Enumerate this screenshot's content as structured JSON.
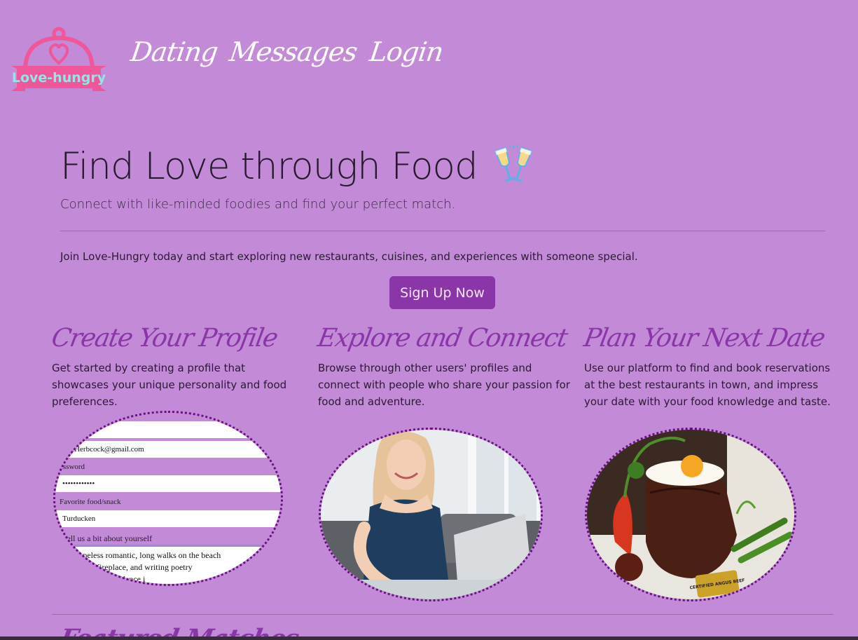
{
  "brand": {
    "logo_text": "Love-hungry"
  },
  "nav": {
    "items": [
      "Dating",
      "Messages",
      "Login"
    ]
  },
  "hero": {
    "title": "Find Love through Food",
    "lead": "Connect with like-minded foodies and find your perfect match.",
    "body": "Join Love-Hungry today and start exploring new restaurants, cuisines, and experiences with someone special.",
    "cta": "Sign Up Now",
    "icon": "clinking-glasses-icon"
  },
  "features": [
    {
      "title": "Create Your Profile",
      "text": "Get started by creating a profile that showcases your unique personality and food preferences."
    },
    {
      "title": "Explore and Connect",
      "text": "Browse through other users' profiles and connect with people who share your passion for food and adventure."
    },
    {
      "title": "Plan Your Next Date",
      "text": "Use our platform to find and book reservations at the best restaurants in town, and impress your date with your food knowledge and taste."
    }
  ],
  "form_preview": {
    "email_value": "rbieHerbcock@gmail.com",
    "password_label": "assword",
    "password_value": "••••••••••••",
    "food_label": "Favorite food/snack",
    "food_value": "Turducken",
    "about_label": "Tell us a bit about yourself",
    "about_line1": "n a hopeless romantic, long walks on the beach",
    "about_line2": "les by the fireplace, and writing poetry",
    "about_line3": "tiful eyes as they dance i"
  },
  "steak_badge": "CERTIFIED ANGUS BEEF",
  "bottom_section_title": "Featured Matches",
  "colors": {
    "background": "#c38ad8",
    "accent": "#8a35a8",
    "dotted_border": "#6a0f82"
  }
}
